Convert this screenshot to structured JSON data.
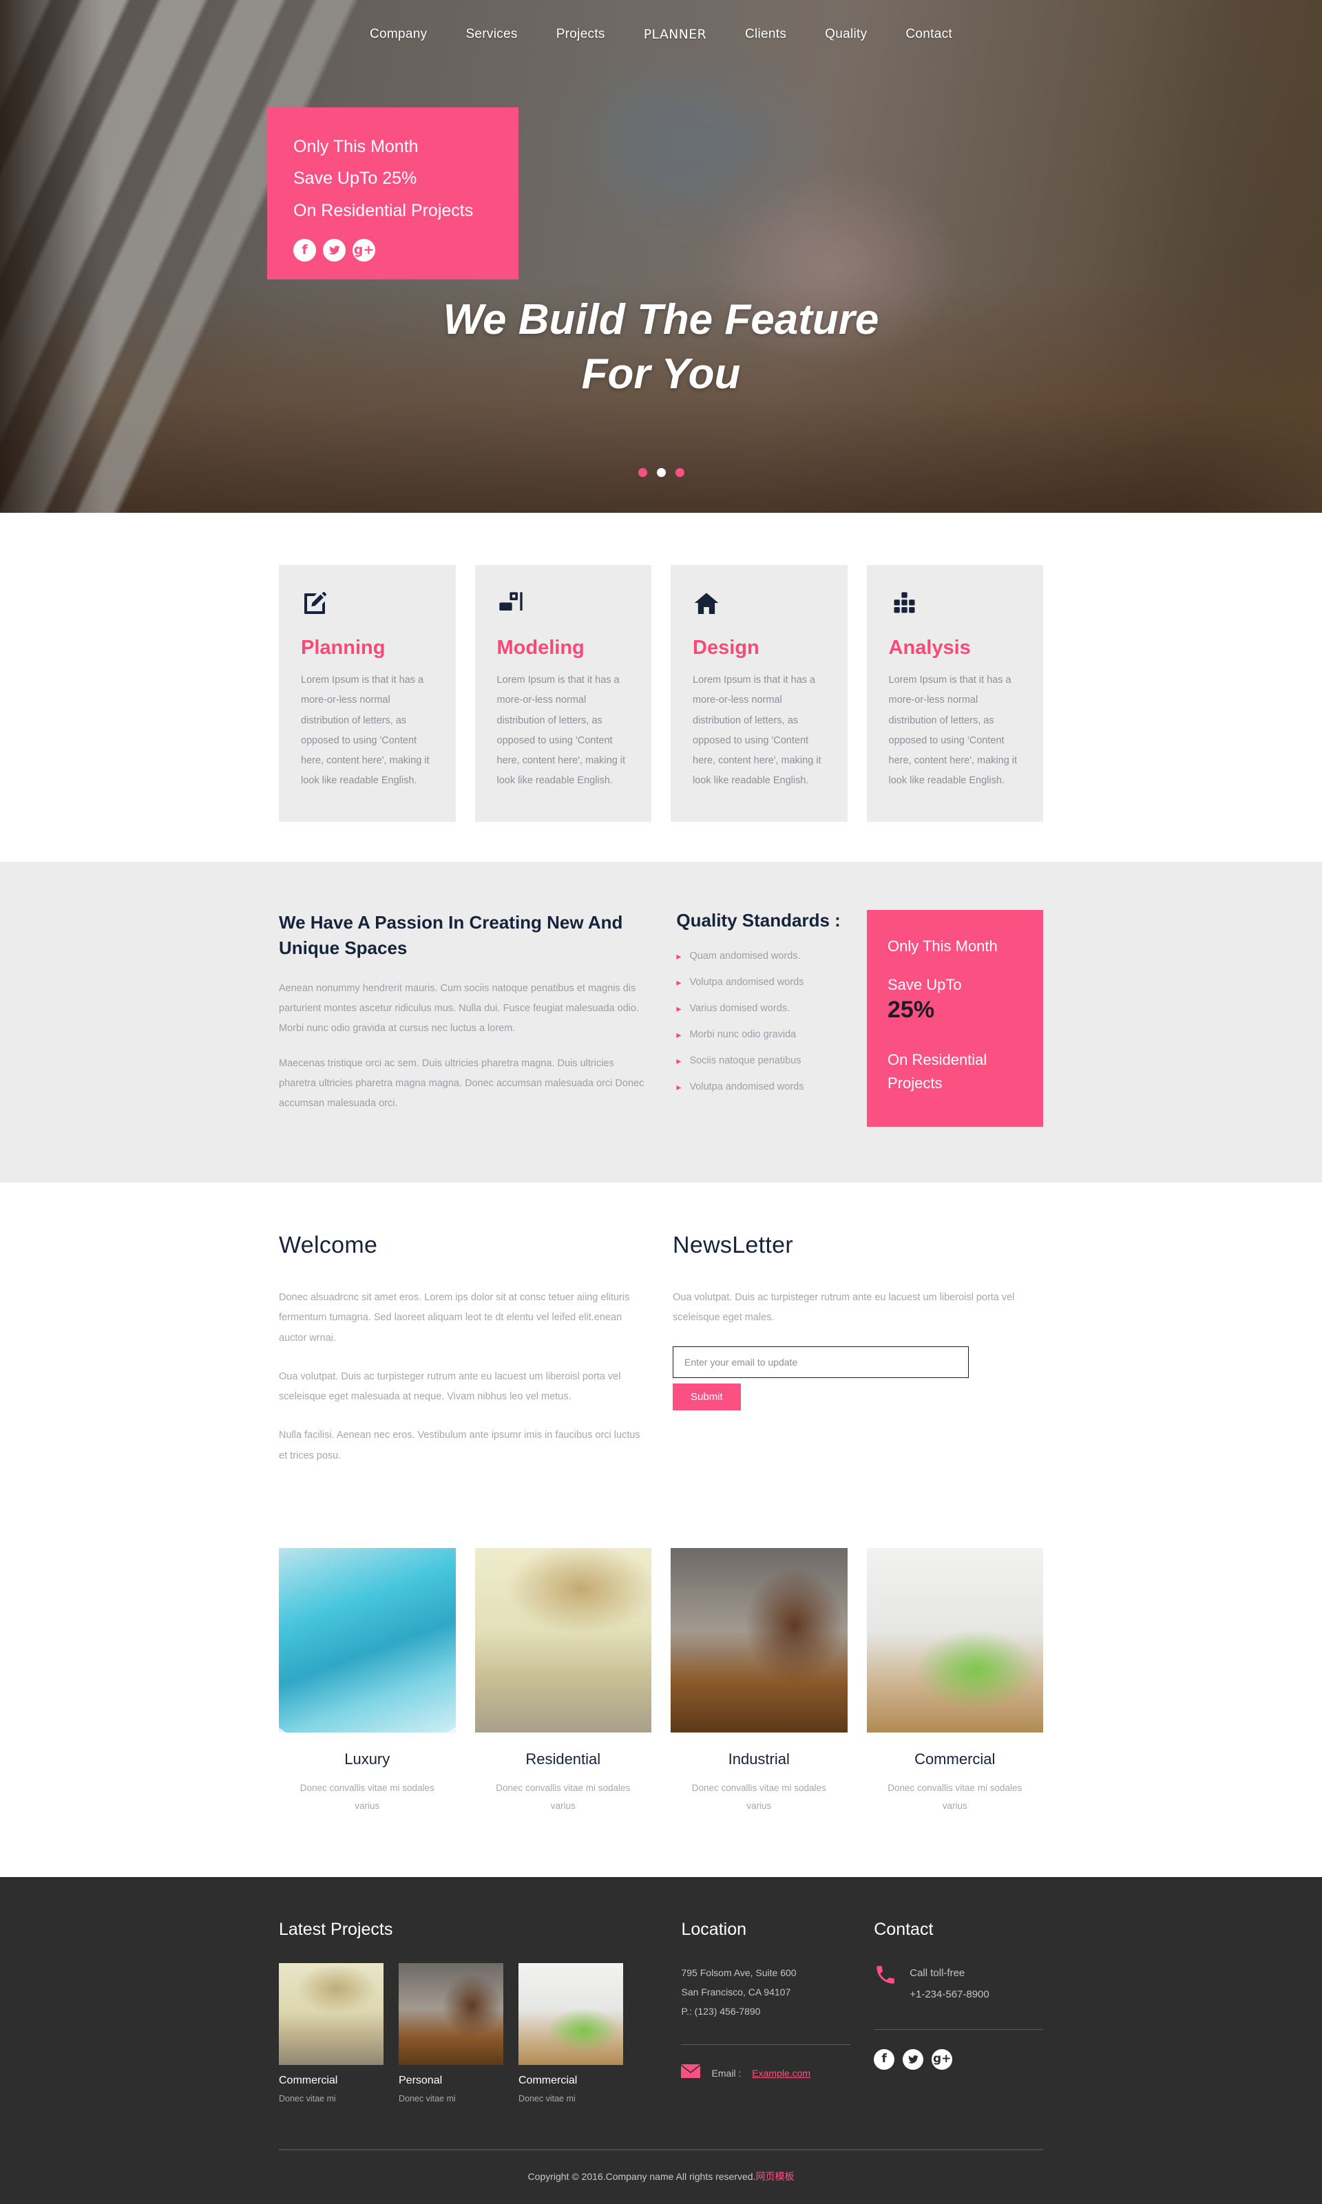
{
  "brand": {
    "logo": "PLANNER",
    "accent": "#fa5182",
    "dark": "#16233b",
    "footer_bg": "#2e2e2e",
    "band_bg": "#ececec"
  },
  "nav": {
    "left": [
      {
        "label": "Company"
      },
      {
        "label": "Services"
      },
      {
        "label": "Projects"
      }
    ],
    "right": [
      {
        "label": "Clients"
      },
      {
        "label": "Quality"
      },
      {
        "label": "Contact"
      }
    ]
  },
  "hero": {
    "promo": {
      "line1": "Only This Month",
      "line2": "Save UpTo 25%",
      "line3": "On Residential Projects",
      "social": [
        {
          "icon": "facebook-icon",
          "glyph": "f"
        },
        {
          "icon": "twitter-icon",
          "glyph": "ᵛ"
        },
        {
          "icon": "google-plus-icon",
          "glyph": "g+"
        }
      ]
    },
    "title_line1": "We Build The Feature",
    "title_line2": "For You",
    "slider_dots": [
      {
        "active": false
      },
      {
        "active": true
      },
      {
        "active": false
      }
    ]
  },
  "services": [
    {
      "icon": "edit-square-icon",
      "title": "Planning",
      "text": "Lorem Ipsum is that it has a more-or-less normal distribution of letters, as opposed to using 'Content here, content here', making it look like readable English."
    },
    {
      "icon": "layout-blocks-icon",
      "title": "Modeling",
      "text": "Lorem Ipsum is that it has a more-or-less normal distribution of letters, as opposed to using 'Content here, content here', making it look like readable English."
    },
    {
      "icon": "home-icon",
      "title": "Design",
      "text": "Lorem Ipsum is that it has a more-or-less normal distribution of letters, as opposed to using 'Content here, content here', making it look like readable English."
    },
    {
      "icon": "bar-chart-dots-icon",
      "title": "Analysis",
      "text": "Lorem Ipsum is that it has a more-or-less normal distribution of letters, as opposed to using 'Content here, content here', making it look like readable English."
    }
  ],
  "passion": {
    "heading": "We Have A Passion In Creating New And Unique Spaces",
    "paragraph1": "Aenean nonummy hendrerit mauris. Cum sociis natoque penatibus et magnis dis parturient montes ascetur ridiculus mus. Nulla dui. Fusce feugiat malesuada odio. Morbi nunc odio gravida at cursus nec luctus a lorem.",
    "paragraph2": "Maecenas tristique orci ac sem. Duis ultricies pharetra magna. Duis ultricies pharetra ultricies pharetra magna magna. Donec accumsan malesuada orci Donec accumsan malesuada orci.",
    "quality_heading": "Quality Standards :",
    "quality_items": [
      "Quam andomised words.",
      "Volutpa andomised words",
      "Varius domised words.",
      "Morbi nunc odio gravida",
      "Sociis natoque penatibus",
      "Volutpa andomised words"
    ],
    "offer": {
      "line1": "Only This Month",
      "line2": "Save UpTo",
      "percent": "25%",
      "line3": "On Residential Projects"
    }
  },
  "welcome": {
    "heading": "Welcome",
    "p1": "Donec alsuadrcnc sit amet eros. Lorem ips dolor sit at consc tetuer aiing elituris fermentum tumagna. Sed laoreet aliquam leot te dt elentu vel leifed elit.enean auctor wrnai.",
    "p2": "Oua volutpat. Duis ac turpisteger rutrum ante eu lacuest um liberoisl porta vel sceleisque eget malesuada at neque. Vivam nibhus leo vel metus.",
    "p3": "Nulla facilisi. Aenean nec eros. Vestibulum ante ipsumr imis in faucibus orci luctus et trices posu."
  },
  "newsletter": {
    "heading": "NewsLetter",
    "text": "Oua volutpat. Duis ac turpisteger rutrum ante eu lacuest um liberoisl porta vel sceleisque eget males.",
    "input_value": "",
    "input_placeholder": "Enter your email to update",
    "submit_label": "Submit"
  },
  "gallery": [
    {
      "photo": "ph1",
      "title": "Luxury",
      "caption": "Donec convallis vitae mi sodales varius"
    },
    {
      "photo": "ph2",
      "title": "Residential",
      "caption": "Donec convallis vitae mi sodales varius"
    },
    {
      "photo": "ph3",
      "title": "Industrial",
      "caption": "Donec convallis vitae mi sodales varius"
    },
    {
      "photo": "ph4",
      "title": "Commercial",
      "caption": "Donec convallis vitae mi sodales varius"
    }
  ],
  "footer": {
    "latest_projects": {
      "heading": "Latest Projects",
      "items": [
        {
          "photo": "ph5",
          "title": "Commercial",
          "sub": "Donec vitae mi"
        },
        {
          "photo": "ph3",
          "title": "Personal",
          "sub": "Donec vitae mi"
        },
        {
          "photo": "ph4",
          "title": "Commercial",
          "sub": "Donec vitae mi"
        }
      ]
    },
    "location": {
      "heading": "Location",
      "address1": "795 Folsom Ave, Suite 600",
      "address2": "San Francisco, CA 94107",
      "phone": "P.: (123) 456-7890",
      "email_label": "Email :",
      "email_link": "Example.com"
    },
    "contact": {
      "heading": "Contact",
      "call_label": "Call toll-free",
      "call_number": "+1-234-567-8900",
      "social": [
        {
          "icon": "facebook-icon",
          "glyph": "f"
        },
        {
          "icon": "twitter-icon",
          "glyph": "ᵛ"
        },
        {
          "icon": "google-plus-icon",
          "glyph": "g+"
        }
      ]
    },
    "copyright_text": "Copyright © 2016.Company name All rights reserved.",
    "copyright_cn": "网页模板"
  }
}
